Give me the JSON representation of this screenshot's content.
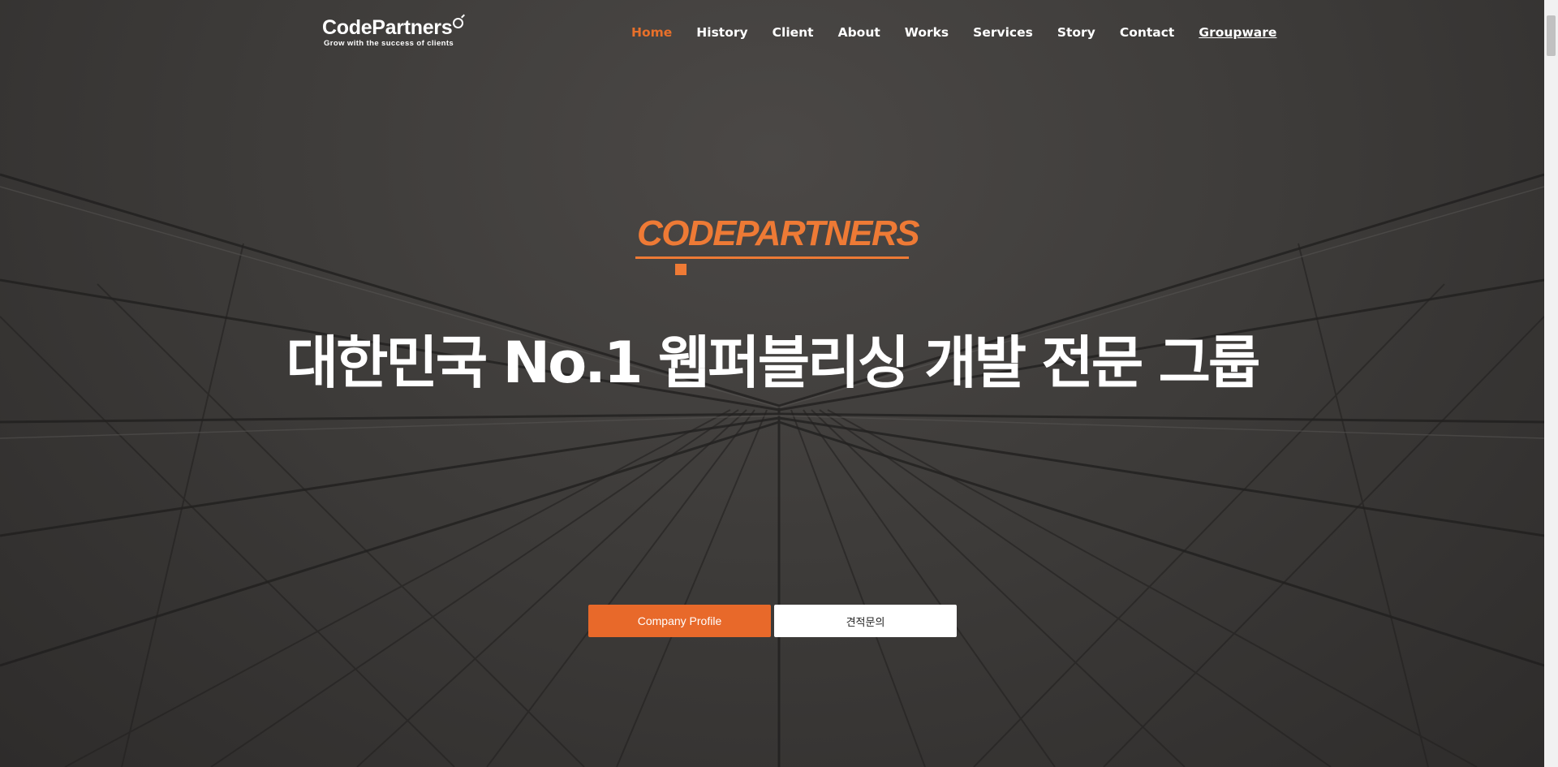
{
  "header": {
    "logo_text": "CodePartners",
    "logo_tagline": "Grow with the success of clients",
    "nav": [
      {
        "label": "Home"
      },
      {
        "label": "History"
      },
      {
        "label": "Client"
      },
      {
        "label": "About"
      },
      {
        "label": "Works"
      },
      {
        "label": "Services"
      },
      {
        "label": "Story"
      },
      {
        "label": "Contact"
      },
      {
        "label": "Groupware"
      }
    ]
  },
  "hero": {
    "brand": "CODEPARTNERS",
    "headline": "대한민국 No.1 웹퍼블리싱 개발 전문 그룹",
    "primary_button": "Company Profile",
    "secondary_button": "견적문의"
  },
  "colors": {
    "accent": "#e8702a",
    "overlay": "#3e3c3a",
    "text": "#ffffff"
  }
}
